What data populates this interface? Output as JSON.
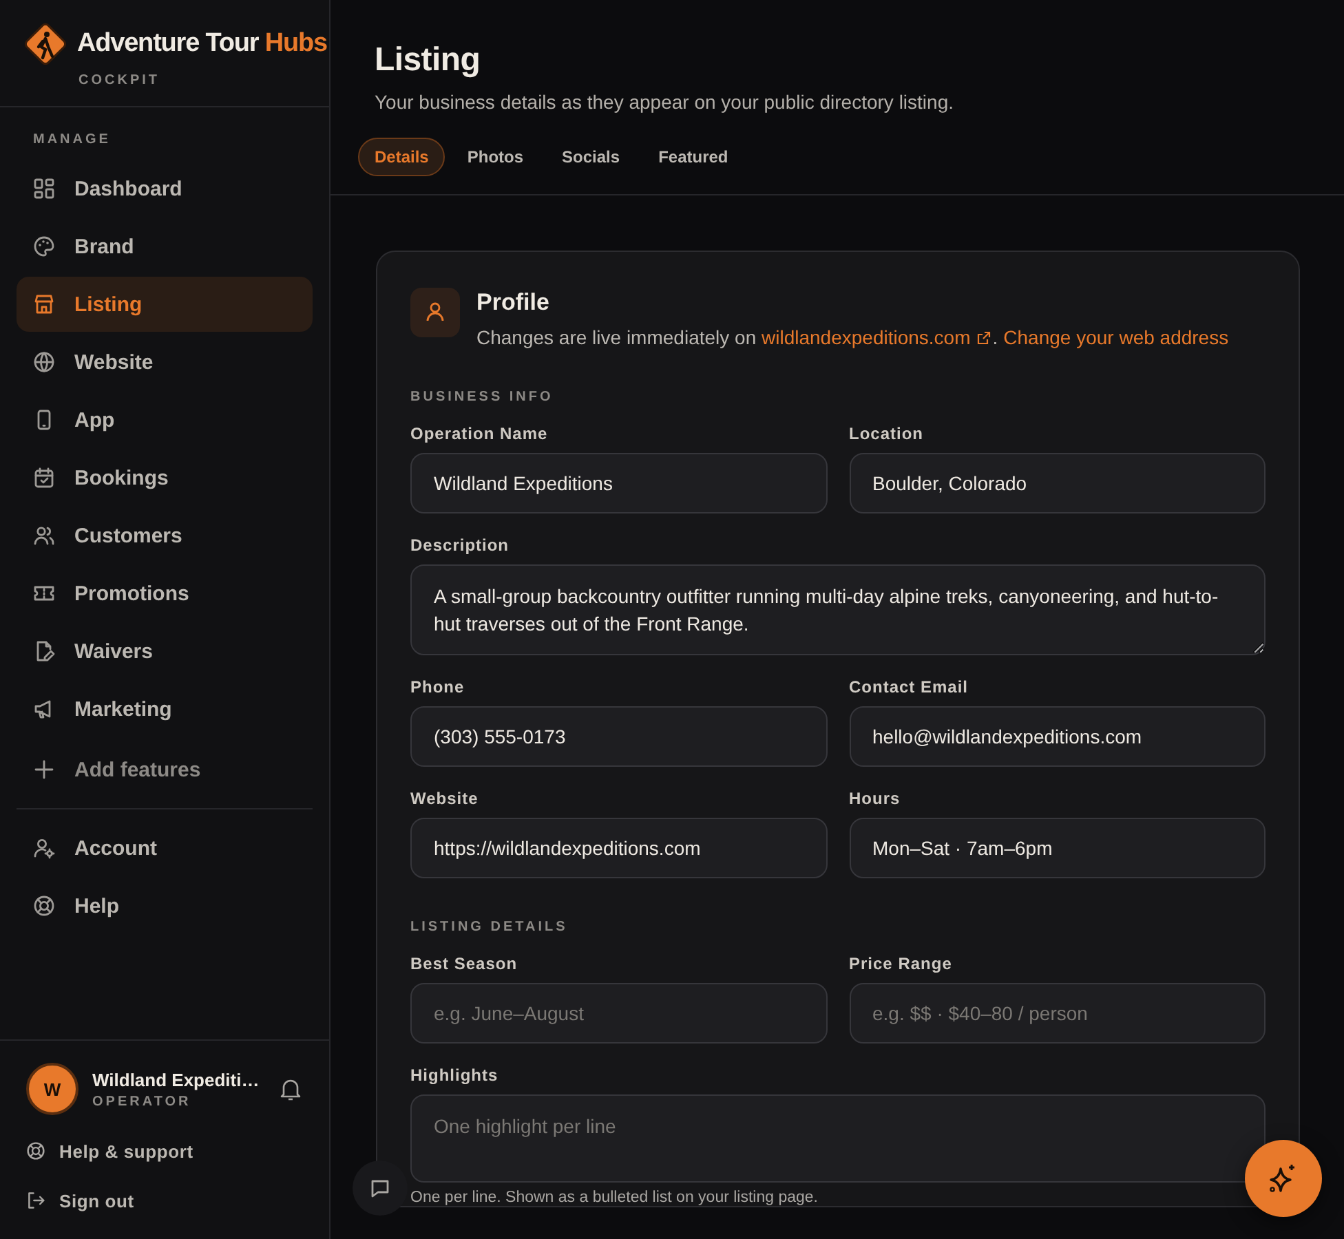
{
  "brand": {
    "name": "Adventure Tour",
    "accent": "Hubs",
    "subtitle": "COCKPIT"
  },
  "sidebar": {
    "section": "MANAGE",
    "items": [
      {
        "label": "Dashboard",
        "selected": false
      },
      {
        "label": "Brand",
        "selected": false
      },
      {
        "label": "Listing",
        "selected": true
      },
      {
        "label": "Website",
        "selected": false
      },
      {
        "label": "App",
        "selected": false
      },
      {
        "label": "Bookings",
        "selected": false
      },
      {
        "label": "Customers",
        "selected": false
      },
      {
        "label": "Promotions",
        "selected": false
      },
      {
        "label": "Waivers",
        "selected": false
      },
      {
        "label": "Marketing",
        "selected": false
      }
    ],
    "add_item": "Add features",
    "secondary_items": [
      {
        "label": "Account",
        "selected": false
      },
      {
        "label": "Help",
        "selected": false
      }
    ]
  },
  "user": {
    "initial": "W",
    "name": "Wildland Expediti…",
    "role": "OPERATOR"
  },
  "footer_links": [
    "Help & support",
    "Sign out"
  ],
  "page": {
    "title": "Listing",
    "subtitle": "Your business details as they appear on your public directory listing."
  },
  "tabs": [
    {
      "label": "Details",
      "selected": true
    },
    {
      "label": "Photos",
      "selected": false
    },
    {
      "label": "Socials",
      "selected": false
    },
    {
      "label": "Featured",
      "selected": false
    }
  ],
  "profile": {
    "title": "Profile",
    "note": "Changes are live immediately on ",
    "domain": "wildlandexpeditions.com",
    "separator": ".",
    "change_link": "Change your web address"
  },
  "sections": [
    {
      "heading": "BUSINESS INFO",
      "fields": [
        {
          "label": "Operation Name",
          "kind": "input",
          "value": "Wildland Expeditions"
        },
        {
          "label": "Location",
          "kind": "input",
          "value": "Boulder, Colorado"
        },
        {
          "label": "Description",
          "kind": "textarea",
          "value": "A small-group backcountry outfitter running multi-day alpine treks, canyoneering, and hut-to-hut traverses out of the Front Range."
        },
        {
          "label": "Phone",
          "kind": "input",
          "value": "(303) 555-0173"
        },
        {
          "label": "Contact Email",
          "kind": "input",
          "value": "hello@wildlandexpeditions.com"
        },
        {
          "label": "Website",
          "kind": "input",
          "value": "https://wildlandexpeditions.com"
        },
        {
          "label": "Hours",
          "kind": "input",
          "value": "Mon–Sat · 7am–6pm"
        }
      ]
    },
    {
      "heading": "LISTING DETAILS",
      "fields": [
        {
          "label": "Best Season",
          "kind": "input",
          "placeholder": "e.g. June–August"
        },
        {
          "label": "Price Range",
          "kind": "input",
          "placeholder": "e.g. $$ · $40–80 / person"
        },
        {
          "label": "Highlights",
          "kind": "textarea",
          "placeholder": "One highlight per line",
          "hint": "One per line. Shown as a bulleted list on your listing page."
        }
      ]
    }
  ]
}
